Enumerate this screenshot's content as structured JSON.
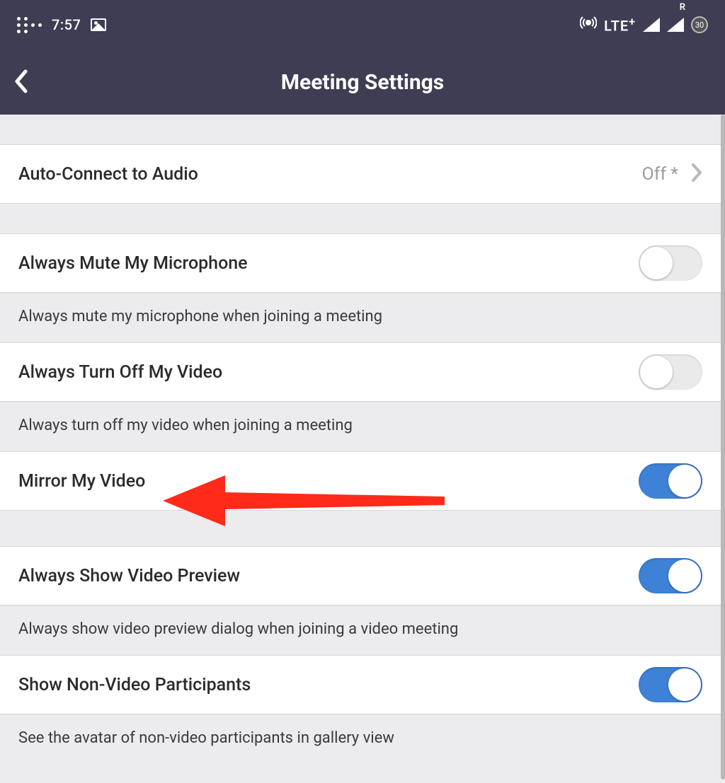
{
  "status": {
    "time": "7:57",
    "lte": "LTE",
    "lte_sup": "+",
    "signal_sup": "R",
    "battery": "30"
  },
  "header": {
    "title": "Meeting Settings"
  },
  "rows": {
    "auto_connect": {
      "label": "Auto-Connect to Audio",
      "value": "Off *"
    },
    "mute_mic": {
      "label": "Always Mute My Microphone",
      "desc": "Always mute my microphone when joining a meeting"
    },
    "turn_off_video": {
      "label": "Always Turn Off My Video",
      "desc": "Always turn off my video when joining a meeting"
    },
    "mirror": {
      "label": "Mirror My Video"
    },
    "preview": {
      "label": "Always Show Video Preview",
      "desc": "Always show video preview dialog when joining a video meeting"
    },
    "non_video": {
      "label": "Show Non-Video Participants",
      "desc": "See the avatar of non-video participants in gallery view"
    }
  }
}
